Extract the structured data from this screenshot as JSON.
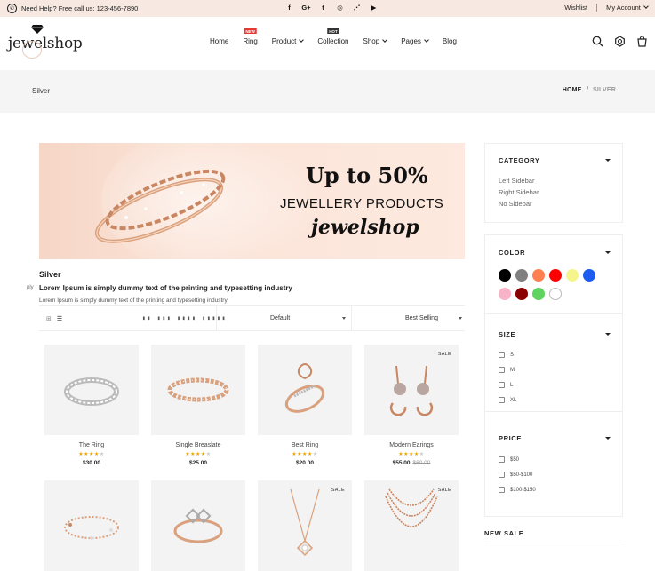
{
  "topbar": {
    "help": "Need Help? Free call us: 123-456-7890",
    "social": [
      {
        "icon": "facebook-icon",
        "glyph": "f"
      },
      {
        "icon": "google-plus-icon",
        "glyph": "G+"
      },
      {
        "icon": "twitter-icon",
        "glyph": "t"
      },
      {
        "icon": "instagram-icon",
        "glyph": "◎"
      },
      {
        "icon": "rss-icon",
        "glyph": "⋰"
      },
      {
        "icon": "youtube-icon",
        "glyph": "▶"
      }
    ],
    "wishlist": "Wishlist",
    "account": "My Account"
  },
  "header": {
    "logo": "jewelshop",
    "nav": [
      {
        "label": "Home",
        "dropdown": false,
        "badge": ""
      },
      {
        "label": "Ring",
        "dropdown": false,
        "badge": "NEW",
        "badge_color": "#e53935"
      },
      {
        "label": "Product",
        "dropdown": true,
        "badge": ""
      },
      {
        "label": "Collection",
        "dropdown": false,
        "badge": "HOT",
        "badge_color": "#333333"
      },
      {
        "label": "Shop",
        "dropdown": true,
        "badge": ""
      },
      {
        "label": "Pages",
        "dropdown": true,
        "badge": ""
      },
      {
        "label": "Blog",
        "dropdown": false,
        "badge": ""
      }
    ],
    "icons": [
      "search-icon",
      "settings-icon",
      "cart-icon"
    ]
  },
  "breadcrumb": {
    "title": "Silver",
    "home": "HOME",
    "separator": "/",
    "current": "SILVER"
  },
  "banner": {
    "headline": "Up to 50%",
    "subline": "JEWELLERY PRODUCTS",
    "brand": "jewelshop"
  },
  "category_page": {
    "title": "Silver",
    "heading": "Lorem Ipsum is simply dummy text of the printing and typesetting industry",
    "heading_fragment": "ply",
    "description": "Lorem Ipsum is simply dummy text of the printing and typesetting industry"
  },
  "toolbar": {
    "view_icons": [
      "grid-view-icon",
      "list-view-icon"
    ],
    "columns_label": "▮▮ ▮▮▮ ▮▮▮▮ ▮▮▮▮▮",
    "sort_default": "Default",
    "sort_by": "Best Selling"
  },
  "products": [
    {
      "name": "The Ring",
      "rating": 4,
      "price": "$30.00",
      "old_price": "",
      "sale": "",
      "kind": "ring-band"
    },
    {
      "name": "Single Breaslate",
      "rating": 4,
      "price": "$25.00",
      "old_price": "",
      "sale": "",
      "kind": "bracelet"
    },
    {
      "name": "Best Ring",
      "rating": 4,
      "price": "$20.00",
      "old_price": "",
      "sale": "",
      "kind": "ring-flower"
    },
    {
      "name": "Modern Earings",
      "rating": 4,
      "price": "$55.00",
      "old_price": "$60.00",
      "sale": "SALE",
      "kind": "earrings"
    },
    {
      "name": "",
      "rating": 0,
      "price": "",
      "old_price": "",
      "sale": "",
      "kind": "bracelet-chain"
    },
    {
      "name": "",
      "rating": 0,
      "price": "",
      "old_price": "",
      "sale": "",
      "kind": "ring-square"
    },
    {
      "name": "",
      "rating": 0,
      "price": "",
      "old_price": "",
      "sale": "SALE",
      "kind": "necklace-pendant"
    },
    {
      "name": "",
      "rating": 0,
      "price": "",
      "old_price": "",
      "sale": "SALE",
      "kind": "necklace-layered"
    }
  ],
  "sidebar": {
    "category": {
      "title": "CATEGORY",
      "items": [
        "Left Sidebar",
        "Right Sidebar",
        "No Sidebar"
      ]
    },
    "color": {
      "title": "COLOR",
      "swatches": [
        "#000000",
        "#808080",
        "#ff7f50",
        "#ff0000",
        "#f5f58c",
        "#1e5cf0",
        "#f7b3c7",
        "#8b0000",
        "#5fd35f",
        "#ffffff"
      ]
    },
    "size": {
      "title": "SIZE",
      "options": [
        "S",
        "M",
        "L",
        "XL"
      ]
    },
    "price": {
      "title": "PRICE",
      "options": [
        "$50",
        "$50-$100",
        "$100-$150"
      ]
    },
    "new_sale": "NEW SALE"
  }
}
